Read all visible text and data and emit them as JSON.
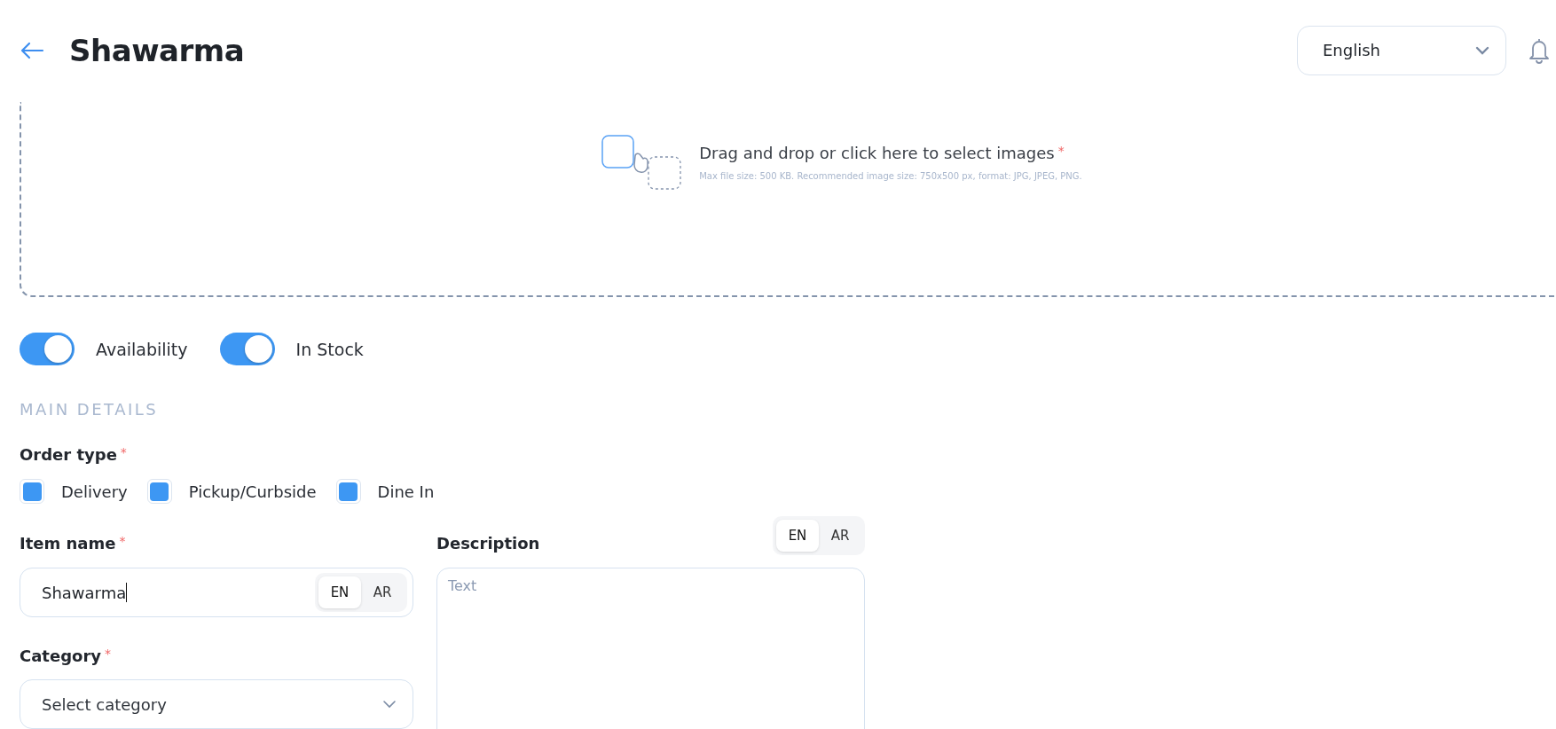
{
  "header": {
    "title": "Shawarma"
  },
  "language_select": {
    "value": "English"
  },
  "upload": {
    "prompt": "Drag and drop or click here to select images",
    "required_mark": "*",
    "hint": "Max file size: 500 KB. Recommended image size: 750x500 px, format: JPG, JPEG, PNG."
  },
  "toggles": [
    {
      "label": "Availability",
      "on": true
    },
    {
      "label": "In Stock",
      "on": true
    }
  ],
  "section_title": "MAIN DETAILS",
  "order_type": {
    "label": "Order type",
    "required_mark": "*",
    "options": [
      {
        "label": "Delivery",
        "checked": true
      },
      {
        "label": "Pickup/Curbside",
        "checked": true
      },
      {
        "label": "Dine In",
        "checked": true
      }
    ]
  },
  "item_name": {
    "label": "Item name",
    "required_mark": "*",
    "value": "Shawarma",
    "languages": [
      {
        "label": "EN",
        "selected": true
      },
      {
        "label": "AR",
        "selected": false
      }
    ]
  },
  "category": {
    "label": "Category",
    "required_mark": "*",
    "placeholder": "Select category"
  },
  "description": {
    "label": "Description",
    "placeholder": "Text",
    "languages": [
      {
        "label": "EN",
        "selected": true
      },
      {
        "label": "AR",
        "selected": false
      }
    ]
  }
}
